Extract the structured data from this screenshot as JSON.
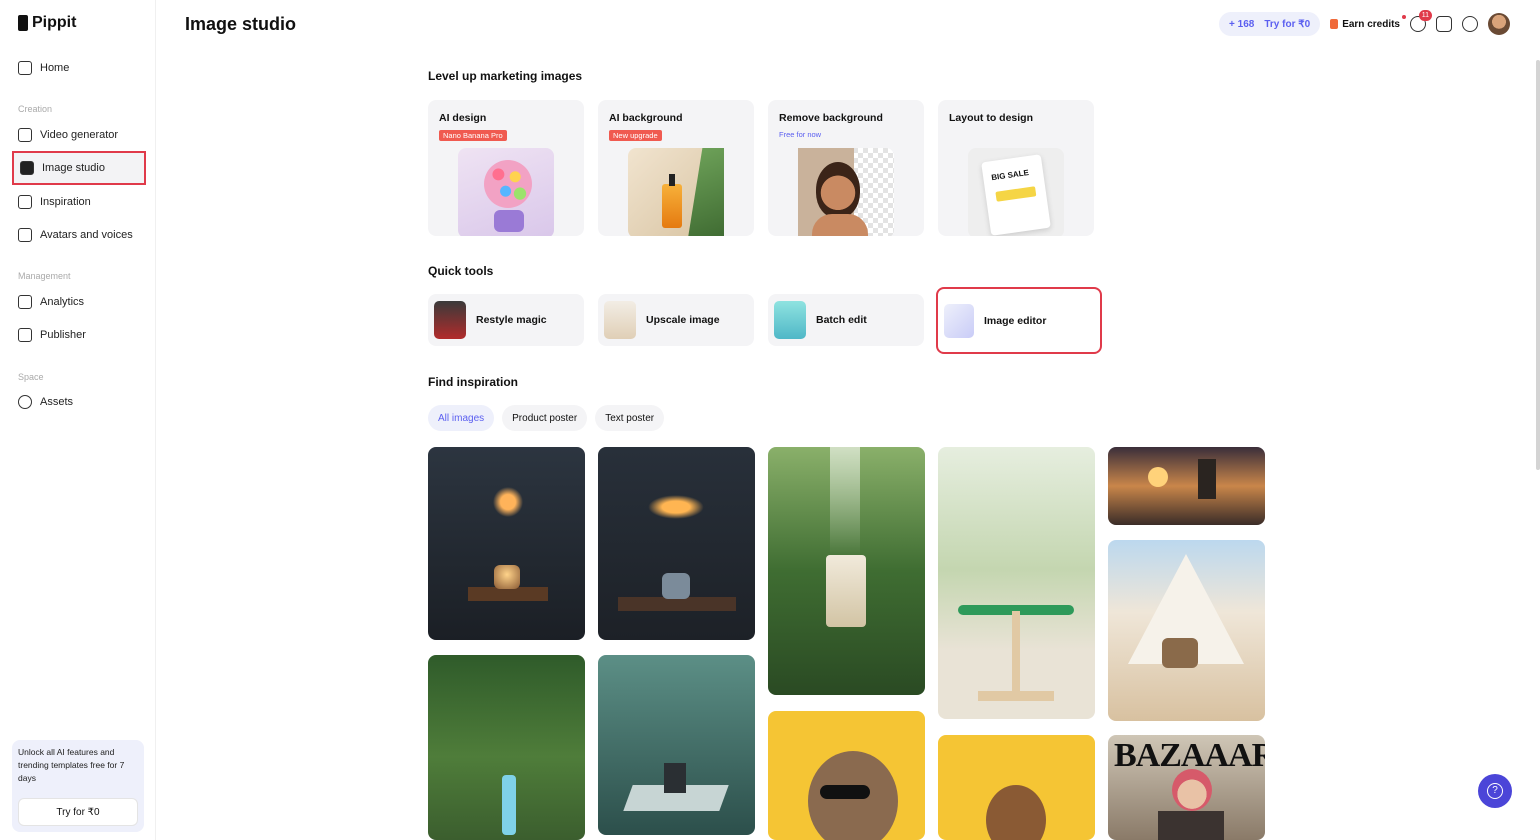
{
  "app": {
    "name": "Pippit"
  },
  "sidebar": {
    "home": "Home",
    "creation_label": "Creation",
    "creation": [
      "Video generator",
      "Image studio",
      "Inspiration",
      "Avatars and voices"
    ],
    "management_label": "Management",
    "management": [
      "Analytics",
      "Publisher"
    ],
    "space_label": "Space",
    "space": [
      "Assets"
    ],
    "active": "Image studio"
  },
  "promo": {
    "text": "Unlock all AI features and trending templates free for 7 days",
    "button": "Try for ₹0"
  },
  "header": {
    "title": "Image studio",
    "credits": "+ 168",
    "try_label": "Try for ₹0",
    "earn_label": "Earn credits",
    "notifications": "11"
  },
  "marketing": {
    "title": "Level up marketing images",
    "cards": [
      {
        "title": "AI design",
        "tag": "Nano Banana Pro",
        "tag_style": "red"
      },
      {
        "title": "AI background",
        "tag": "New upgrade",
        "tag_style": "red"
      },
      {
        "title": "Remove background",
        "tag": "Free for now",
        "tag_style": "blue"
      },
      {
        "title": "Layout to design",
        "tag": "",
        "tag_style": "none"
      }
    ],
    "layout_thumb_text": "BIG SALE"
  },
  "quick_tools": {
    "title": "Quick tools",
    "items": [
      "Restyle magic",
      "Upscale image",
      "Batch edit",
      "Image editor"
    ],
    "highlighted": "Image editor"
  },
  "inspiration": {
    "title": "Find inspiration",
    "chips": [
      "All images",
      "Product poster",
      "Text poster"
    ],
    "active_chip": "All images",
    "magazine_text": "BAZAAAR"
  }
}
